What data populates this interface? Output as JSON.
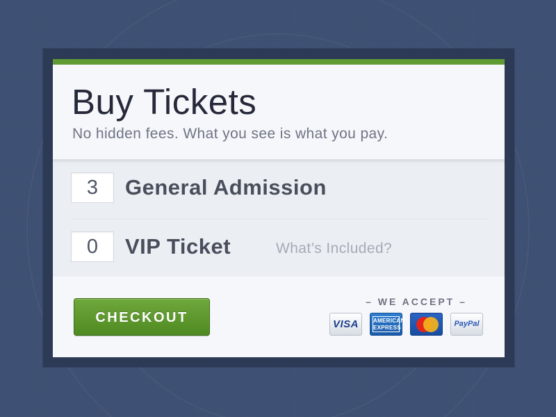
{
  "header": {
    "title": "Buy Tickets",
    "subtitle": "No hidden fees. What you see is what you pay."
  },
  "tickets": [
    {
      "quantity": "3",
      "name": "General Admission",
      "link": ""
    },
    {
      "quantity": "0",
      "name": "VIP Ticket",
      "link": "What’s Included?"
    }
  ],
  "footer": {
    "checkout_label": "CHECKOUT",
    "accept_label": "– WE ACCEPT –",
    "cards": [
      {
        "icon": "visa-icon",
        "label": "VISA"
      },
      {
        "icon": "american-express-icon",
        "label": "AMERICAN EXPRESS"
      },
      {
        "icon": "mastercard-icon",
        "label": ""
      },
      {
        "icon": "paypal-icon",
        "label": "PayPal"
      }
    ]
  },
  "colors": {
    "background": "#3e5074",
    "accent": "#5f9a33",
    "checkout_button": "#5a9a2c",
    "title_text": "#25293a"
  }
}
